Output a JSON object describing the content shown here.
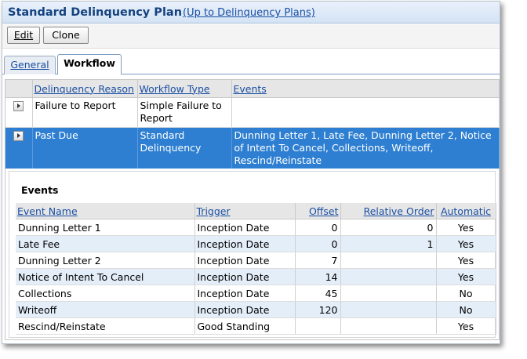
{
  "header": {
    "title": "Standard Delinquency Plan",
    "link": "(Up to Delinquency Plans)"
  },
  "toolbar": {
    "edit_label": "Edit",
    "clone_label": "Clone"
  },
  "tabs": [
    {
      "label": "General",
      "active": false
    },
    {
      "label": "Workflow",
      "active": true
    }
  ],
  "workflow": {
    "columns": [
      "Delinquency Reason",
      "Workflow Type",
      "Events"
    ],
    "rows": [
      {
        "reason": "Failure to Report",
        "type": "Simple Failure to Report",
        "events": "",
        "selected": false
      },
      {
        "reason": "Past Due",
        "type": "Standard Delinquency",
        "events": "Dunning Letter 1, Late Fee, Dunning Letter 2, Notice of Intent To Cancel, Collections, Writeoff, Rescind/Reinstate",
        "selected": true
      }
    ]
  },
  "events": {
    "heading": "Events",
    "columns": [
      "Event Name",
      "Trigger",
      "Offset",
      "Relative Order",
      "Automatic"
    ],
    "rows": [
      [
        "Dunning Letter 1",
        "Inception Date",
        "0",
        "0",
        "Yes"
      ],
      [
        "Late Fee",
        "Inception Date",
        "0",
        "1",
        "Yes"
      ],
      [
        "Dunning Letter 2",
        "Inception Date",
        "7",
        "",
        "Yes"
      ],
      [
        "Notice of Intent To Cancel",
        "Inception Date",
        "14",
        "",
        "Yes"
      ],
      [
        "Collections",
        "Inception Date",
        "45",
        "",
        "No"
      ],
      [
        "Writeoff",
        "Inception Date",
        "120",
        "",
        "No"
      ],
      [
        "Rescind/Reinstate",
        "Good Standing",
        "",
        "",
        "Yes"
      ]
    ]
  },
  "colors": {
    "selected_row": "#2e7fd1",
    "alt_row": "#e4eef9",
    "link": "#1a4fa3",
    "title": "#15427f"
  }
}
